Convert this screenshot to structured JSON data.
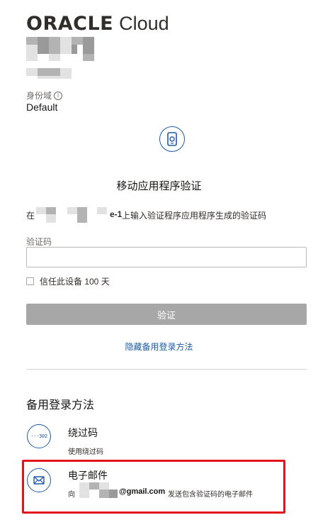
{
  "brand": {
    "logo_mark": "ORACLE",
    "logo_product": "Cloud"
  },
  "domain": {
    "label": "身份域",
    "info_icon": "info-icon",
    "value": "Default"
  },
  "verify": {
    "icon": "mobile-phone-icon",
    "title": "移动应用程序验证",
    "instruction_pre": "在",
    "instruction_bold": "e-1",
    "instruction_post": "上输入验证程序应用程序生成的验证码",
    "code_label": "验证码",
    "code_value": "",
    "trust_label": "信任此设备 100 天",
    "trust_checked": false,
    "submit_label": "验证",
    "hide_link": "隐藏备用登录方法"
  },
  "backup": {
    "title": "备用登录方法",
    "methods": [
      {
        "icon": "bypass-code-icon",
        "icon_glyph": "···302",
        "title": "绕过码",
        "desc": "使用绕过码"
      },
      {
        "icon": "envelope-icon",
        "title": "电子邮件",
        "desc_pre": "向",
        "desc_mail": "@gmail.com",
        "desc_post": "发送包含验证码的电子邮件"
      }
    ]
  },
  "colors": {
    "accent": "#1e5aa8",
    "highlight": "#e3141d",
    "button_disabled": "#a7a7a7",
    "text": "#161513"
  }
}
